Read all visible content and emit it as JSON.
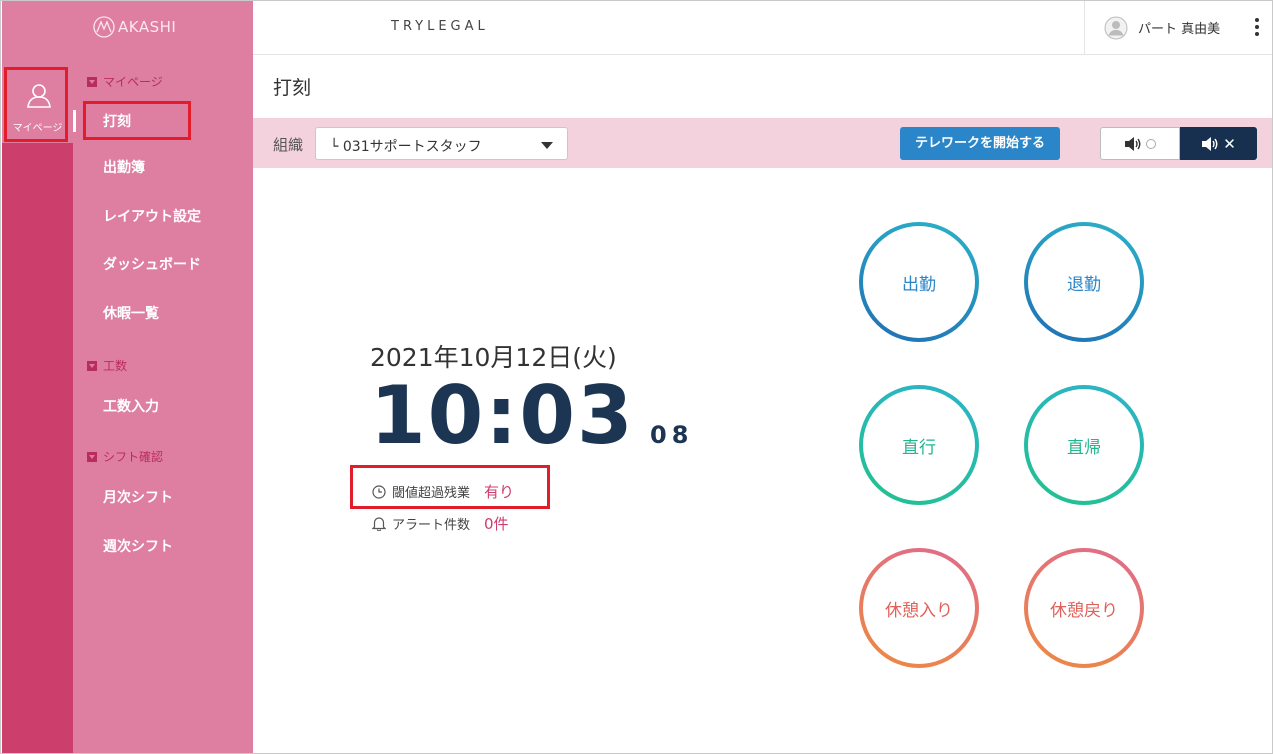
{
  "app": {
    "logo": "AKASHI",
    "company": "TRYLEGAL"
  },
  "user": {
    "name": "パート 真由美"
  },
  "rail": {
    "mypage_label": "マイページ"
  },
  "sidebar": {
    "sections": [
      {
        "title": "マイページ",
        "items": [
          "打刻",
          "出勤簿",
          "レイアウト設定",
          "ダッシュボード",
          "休暇一覧"
        ]
      },
      {
        "title": "工数",
        "items": [
          "工数入力"
        ]
      },
      {
        "title": "シフト確認",
        "items": [
          "月次シフト",
          "週次シフト"
        ]
      }
    ],
    "active_item": "打刻"
  },
  "page": {
    "title": "打刻"
  },
  "toolbar": {
    "org_label": "組織",
    "org_value": "└ 031サポートスタッフ",
    "telework_button": "テレワークを開始する",
    "sound_on_icon": "speaker-icon",
    "sound_off_icon": "speaker-mute-icon",
    "sound_selected": "off"
  },
  "clock": {
    "date": "2021年10月12日(火)",
    "time": "10:03",
    "seconds": "08"
  },
  "info": {
    "overtime_label": "閾値超過残業",
    "overtime_value": "有り",
    "alert_label": "アラート件数",
    "alert_value": "0件"
  },
  "punch": {
    "clock_in": "出勤",
    "clock_out": "退勤",
    "direct_go": "直行",
    "direct_return": "直帰",
    "break_start": "休憩入り",
    "break_end": "休憩戻り"
  },
  "colors": {
    "rail": "#cc3e6c",
    "sidebar": "#de7ea0",
    "toolbar": "#f3d2de",
    "primary_button": "#2a86c9",
    "clock": "#1b3553",
    "alert_value": "#cc3e6c"
  }
}
